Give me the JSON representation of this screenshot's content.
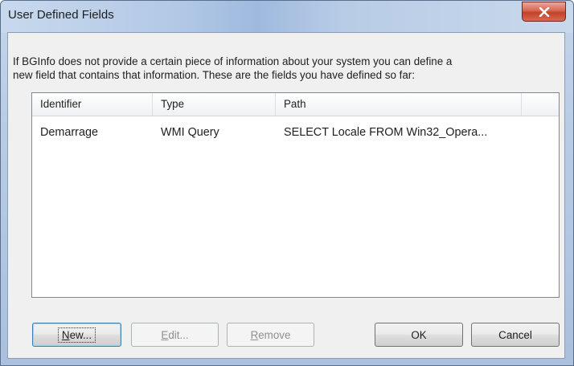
{
  "window": {
    "title": "User Defined Fields"
  },
  "description": {
    "line1": "If BGInfo does not provide a certain piece of information about your system you can define a",
    "line2": "new field that contains that information. These are the fields you have defined so far:"
  },
  "list": {
    "columns": {
      "identifier": "Identifier",
      "type": "Type",
      "path": "Path"
    },
    "rows": [
      {
        "identifier": "Demarrage",
        "type": "WMI Query",
        "path": "SELECT Locale FROM Win32_Opera..."
      }
    ]
  },
  "buttons": {
    "new": {
      "mnemonic": "N",
      "rest": "ew..."
    },
    "edit": {
      "mnemonic": "E",
      "rest": "dit..."
    },
    "remove": {
      "mnemonic": "R",
      "rest": "emove"
    },
    "ok": "OK",
    "cancel": "Cancel"
  },
  "icons": {
    "close": "close-icon"
  },
  "colors": {
    "close_button": "#c2422b",
    "titlebar": "#b3c9e6",
    "client_background": "#f0f0f0"
  }
}
